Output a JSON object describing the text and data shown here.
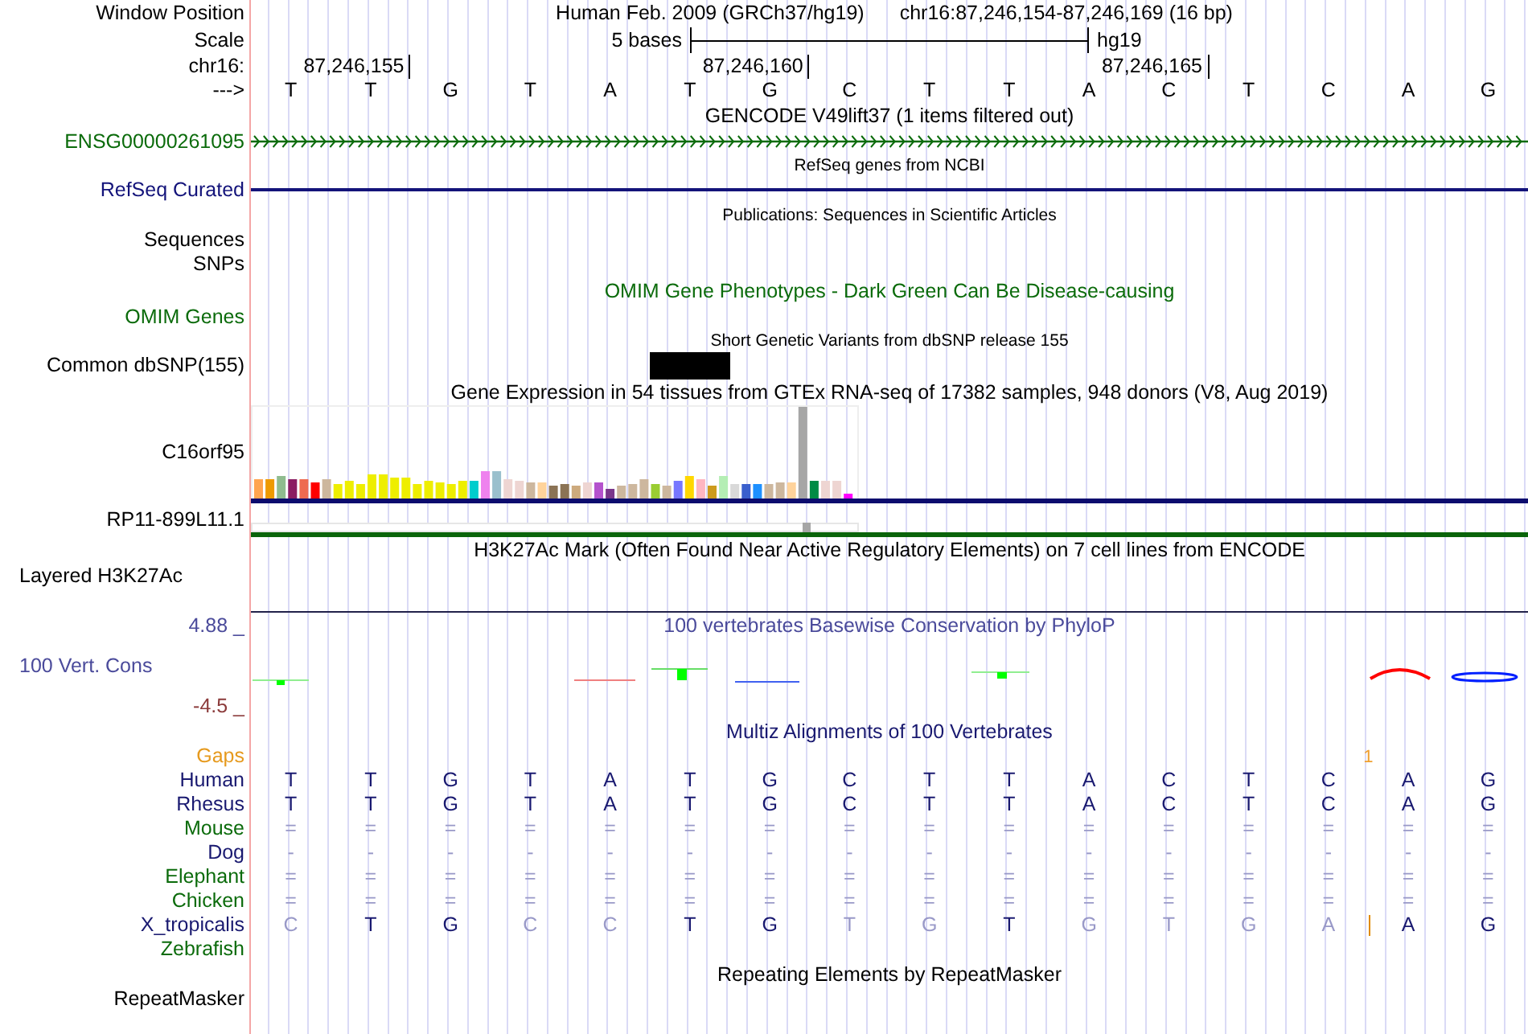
{
  "header": {
    "position_label": "Window Position",
    "assembly": "Human Feb. 2009 (GRCh37/hg19)",
    "range": "chr16:87,246,154-87,246,169 (16 bp)",
    "scale_label": "Scale",
    "scale_text": "5 bases",
    "scale_db": "hg19",
    "chrom_label": "chr16:",
    "positions": [
      "87,246,155",
      "87,246,160",
      "87,246,165"
    ],
    "strand_label": "--->",
    "bases": [
      "T",
      "T",
      "G",
      "T",
      "A",
      "T",
      "G",
      "C",
      "T",
      "T",
      "A",
      "C",
      "T",
      "C",
      "A",
      "G"
    ]
  },
  "tracks": [
    {
      "kind": "gene",
      "title": "GENCODE V49lift37 (1 items filtered out)",
      "label": "ENSG00000261095",
      "color": "#0b6b0b"
    },
    {
      "kind": "line",
      "title": "RefSeq genes from NCBI",
      "label": "RefSeq Curated",
      "color": "#13137a"
    },
    {
      "kind": "publications",
      "title": "Publications: Sequences in Scientific Articles",
      "labels": [
        "Sequences",
        "SNPs"
      ]
    },
    {
      "kind": "omim",
      "title": "OMIM Gene Phenotypes - Dark Green Can Be Disease-causing",
      "label": "OMIM Genes",
      "color": "#0b6b0b"
    },
    {
      "kind": "snp",
      "title": "Short Genetic Variants from dbSNP release 155",
      "label": "Common dbSNP(155)"
    },
    {
      "kind": "expression",
      "title": "Gene Expression in 54 tissues from GTEx RNA-seq of 17382 samples, 948 donors (V8, Aug 2019)",
      "genes": [
        "C16orf95",
        "RP11-899L11.1"
      ]
    },
    {
      "kind": "signal",
      "title": "H3K27Ac Mark (Often Found Near Active Regulatory Elements) on 7 cell lines from ENCODE",
      "label": "Layered H3K27Ac"
    },
    {
      "kind": "conservation",
      "title": "100 vertebrates Basewise Conservation by PhyloP",
      "label": "100 Vert. Cons",
      "max": "4.88 _",
      "min": "-4.5 _",
      "color": "#4b4b9b"
    },
    {
      "kind": "alignment",
      "title": "Multiz Alignments of 100 Vertebrates",
      "gaps_label": "Gaps",
      "gap_count": "1",
      "species": [
        {
          "name": "Human",
          "color": "#191970",
          "cells": [
            {
              "base": "T",
              "faded": false
            },
            {
              "base": "T",
              "faded": false
            },
            {
              "base": "G",
              "faded": false
            },
            {
              "base": "T",
              "faded": false
            },
            {
              "base": "A",
              "faded": false
            },
            {
              "base": "T",
              "faded": false
            },
            {
              "base": "G",
              "faded": false
            },
            {
              "base": "C",
              "faded": false
            },
            {
              "base": "T",
              "faded": false
            },
            {
              "base": "T",
              "faded": false
            },
            {
              "base": "A",
              "faded": false
            },
            {
              "base": "C",
              "faded": false
            },
            {
              "base": "T",
              "faded": false
            },
            {
              "base": "C",
              "faded": false
            },
            {
              "base": "A",
              "faded": false
            },
            {
              "base": "G",
              "faded": false
            }
          ]
        },
        {
          "name": "Rhesus",
          "color": "#191970",
          "cells": [
            {
              "base": "T",
              "faded": false
            },
            {
              "base": "T",
              "faded": false
            },
            {
              "base": "G",
              "faded": false
            },
            {
              "base": "T",
              "faded": false
            },
            {
              "base": "A",
              "faded": false
            },
            {
              "base": "T",
              "faded": false
            },
            {
              "base": "G",
              "faded": false
            },
            {
              "base": "C",
              "faded": false
            },
            {
              "base": "T",
              "faded": false
            },
            {
              "base": "T",
              "faded": false
            },
            {
              "base": "A",
              "faded": false
            },
            {
              "base": "C",
              "faded": false
            },
            {
              "base": "T",
              "faded": false
            },
            {
              "base": "C",
              "faded": false
            },
            {
              "base": "A",
              "faded": false
            },
            {
              "base": "G",
              "faded": false
            }
          ]
        },
        {
          "name": "Mouse",
          "color": "#0b6b0b",
          "cells": [
            {
              "base": "=",
              "faded": true
            },
            {
              "base": "=",
              "faded": true
            },
            {
              "base": "=",
              "faded": true
            },
            {
              "base": "=",
              "faded": true
            },
            {
              "base": "=",
              "faded": true
            },
            {
              "base": "=",
              "faded": true
            },
            {
              "base": "=",
              "faded": true
            },
            {
              "base": "=",
              "faded": true
            },
            {
              "base": "=",
              "faded": true
            },
            {
              "base": "=",
              "faded": true
            },
            {
              "base": "=",
              "faded": true
            },
            {
              "base": "=",
              "faded": true
            },
            {
              "base": "=",
              "faded": true
            },
            {
              "base": "=",
              "faded": true
            },
            {
              "base": "=",
              "faded": true
            },
            {
              "base": "=",
              "faded": true
            }
          ]
        },
        {
          "name": "Dog",
          "color": "#191970",
          "cells": [
            {
              "base": "-",
              "faded": true
            },
            {
              "base": "-",
              "faded": true
            },
            {
              "base": "-",
              "faded": true
            },
            {
              "base": "-",
              "faded": true
            },
            {
              "base": "-",
              "faded": true
            },
            {
              "base": "-",
              "faded": true
            },
            {
              "base": "-",
              "faded": true
            },
            {
              "base": "-",
              "faded": true
            },
            {
              "base": "-",
              "faded": true
            },
            {
              "base": "-",
              "faded": true
            },
            {
              "base": "-",
              "faded": true
            },
            {
              "base": "-",
              "faded": true
            },
            {
              "base": "-",
              "faded": true
            },
            {
              "base": "-",
              "faded": true
            },
            {
              "base": "-",
              "faded": true
            },
            {
              "base": "-",
              "faded": true
            }
          ]
        },
        {
          "name": "Elephant",
          "color": "#0b6b0b",
          "cells": [
            {
              "base": "=",
              "faded": true
            },
            {
              "base": "=",
              "faded": true
            },
            {
              "base": "=",
              "faded": true
            },
            {
              "base": "=",
              "faded": true
            },
            {
              "base": "=",
              "faded": true
            },
            {
              "base": "=",
              "faded": true
            },
            {
              "base": "=",
              "faded": true
            },
            {
              "base": "=",
              "faded": true
            },
            {
              "base": "=",
              "faded": true
            },
            {
              "base": "=",
              "faded": true
            },
            {
              "base": "=",
              "faded": true
            },
            {
              "base": "=",
              "faded": true
            },
            {
              "base": "=",
              "faded": true
            },
            {
              "base": "=",
              "faded": true
            },
            {
              "base": "=",
              "faded": true
            },
            {
              "base": "=",
              "faded": true
            }
          ]
        },
        {
          "name": "Chicken",
          "color": "#0b6b0b",
          "cells": [
            {
              "base": "=",
              "faded": true
            },
            {
              "base": "=",
              "faded": true
            },
            {
              "base": "=",
              "faded": true
            },
            {
              "base": "=",
              "faded": true
            },
            {
              "base": "=",
              "faded": true
            },
            {
              "base": "=",
              "faded": true
            },
            {
              "base": "=",
              "faded": true
            },
            {
              "base": "=",
              "faded": true
            },
            {
              "base": "=",
              "faded": true
            },
            {
              "base": "=",
              "faded": true
            },
            {
              "base": "=",
              "faded": true
            },
            {
              "base": "=",
              "faded": true
            },
            {
              "base": "=",
              "faded": true
            },
            {
              "base": "=",
              "faded": true
            },
            {
              "base": "=",
              "faded": true
            },
            {
              "base": "=",
              "faded": true
            }
          ]
        },
        {
          "name": "X_tropicalis",
          "color": "#191970",
          "insertion": true,
          "cells": [
            {
              "base": "C",
              "faded": true
            },
            {
              "base": "T",
              "faded": false
            },
            {
              "base": "G",
              "faded": false
            },
            {
              "base": "C",
              "faded": true
            },
            {
              "base": "C",
              "faded": true
            },
            {
              "base": "T",
              "faded": false
            },
            {
              "base": "G",
              "faded": false
            },
            {
              "base": "T",
              "faded": true
            },
            {
              "base": "G",
              "faded": true
            },
            {
              "base": "T",
              "faded": false
            },
            {
              "base": "G",
              "faded": true
            },
            {
              "base": "T",
              "faded": true
            },
            {
              "base": "G",
              "faded": true
            },
            {
              "base": "A",
              "faded": true
            },
            {
              "base": "A",
              "faded": false
            },
            {
              "base": "G",
              "faded": false
            }
          ]
        },
        {
          "name": "Zebrafish",
          "color": "#0b6b0b"
        }
      ]
    },
    {
      "kind": "repeats",
      "title": "Repeating Elements by RepeatMasker",
      "label": "RepeatMasker"
    }
  ]
}
